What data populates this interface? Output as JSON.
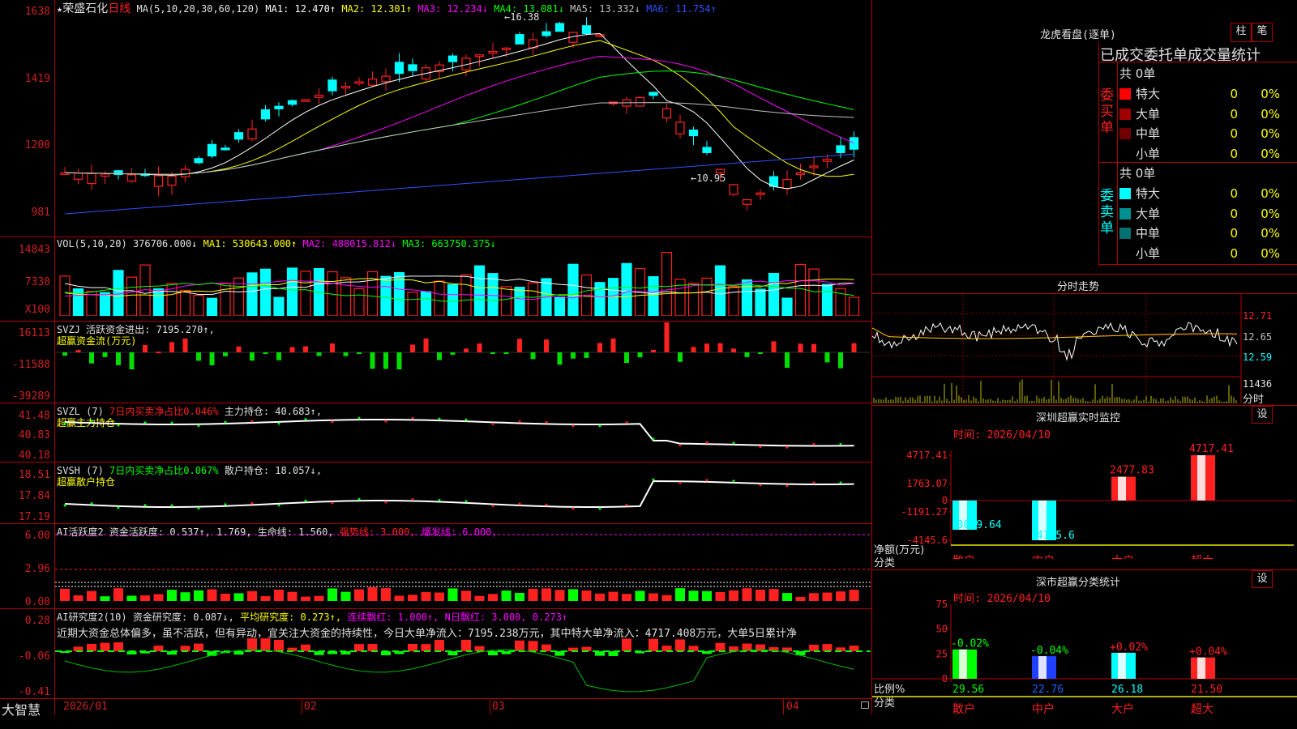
{
  "app": {
    "name": "大智慧"
  },
  "main_chart": {
    "star": "★",
    "stock_name": "荣盛石化",
    "period": "日线",
    "ma_params": "MA(5,10,20,30,60,120)",
    "ma1": "MA1: 12.470↑",
    "ma2": "MA2: 12.301↑",
    "ma3": "MA3: 12.234↓",
    "ma4": "MA4: 13.081↓",
    "ma5": "MA5: 13.332↓",
    "ma6": "MA6: 11.754↑",
    "high_label": "←16.38",
    "low_label": "←10.95",
    "y_ticks": [
      "1638",
      "1419",
      "1200",
      "981"
    ],
    "colors": {
      "ma1": "#ffffff",
      "ma2": "#ffff00",
      "ma3": "#ff00ff",
      "ma4": "#00ff00",
      "ma5": "#c0c0c0",
      "ma6": "#3050ff",
      "up": "#ff2020",
      "down": "#00ffff"
    }
  },
  "vol_panel": {
    "label": "VOL(5,10,20)",
    "value": "376706.000↓",
    "ma1": "MA1: 530643.000↑",
    "ma2": "MA2: 488015.812↓",
    "ma3": "MA3: 663750.375↓",
    "y_ticks": [
      "14843",
      "7330",
      "X100"
    ]
  },
  "svzj_panel": {
    "label": "SVZJ",
    "text": "活跃资金进出: 7195.270↑,",
    "sub": "超赢资金流(万元)",
    "y_ticks": [
      "16113",
      "-11588",
      "-39289"
    ]
  },
  "svzl_panel": {
    "label": "SVZL (7)",
    "ratio": "7日内买卖净占比0.046%",
    "hold": "主力持仓: 40.683↑,",
    "sub": "超赢主力持仓",
    "y_ticks": [
      "41.48",
      "40.83",
      "40.18"
    ]
  },
  "svsh_panel": {
    "label": "SVSH (7)",
    "ratio": "7日内买卖净占比0.067%",
    "hold": "散户持仓: 18.057↓,",
    "sub": "超赢散户持仓",
    "y_ticks": [
      "18.51",
      "17.84",
      "17.19"
    ]
  },
  "ai_active_panel": {
    "label": "AI活跃度2",
    "text1": "资金活跃度: 0.537↑, 1.769, 生命线: 1.560,",
    "strong": "强势线: 3.000,",
    "burst": "爆发线: 6.000,",
    "y_ticks": [
      "6.00",
      "2.96",
      "0.00"
    ]
  },
  "ai_research_panel": {
    "label": "AI研究度2(10)",
    "research": "资金研究度: 0.087↓,",
    "avg": "平均研究度: 0.273↑,",
    "cont": "连续飘红: 1.000↑,",
    "nday": "N日飘红: 3.000, 0.273↑",
    "comment": "近期大资金总体偏多，虽不活跃，但有异动，宜关注大资金的持续性，今日大单净流入：7195.238万元，其中特大单净流入：4717.408万元，大单5日累计净",
    "y_ticks": [
      "0.28",
      "-0.06",
      "-0.41"
    ]
  },
  "x_axis": {
    "labels": [
      "2026/01",
      "02",
      "03",
      "04"
    ]
  },
  "dragon_tiger": {
    "title": "龙虎看盘(逐单)",
    "btn1": "柱",
    "btn2": "笔",
    "subtitle": "已成交委托单成交量统计",
    "buy_label": "委买单",
    "sell_label": "委卖单",
    "buy_total": "共 0单",
    "sell_total": "共 0单",
    "buy_rows": [
      {
        "name": "特大",
        "count": "0",
        "pct": "0%",
        "color": "#ff0000"
      },
      {
        "name": "大单",
        "count": "0",
        "pct": "0%",
        "color": "#a00000"
      },
      {
        "name": "中单",
        "count": "0",
        "pct": "0%",
        "color": "#700000"
      },
      {
        "name": "小单",
        "count": "0",
        "pct": "0%",
        "color": "#000000"
      }
    ],
    "sell_rows": [
      {
        "name": "特大",
        "count": "0",
        "pct": "0%",
        "color": "#00ffff"
      },
      {
        "name": "大单",
        "count": "0",
        "pct": "0%",
        "color": "#009090"
      },
      {
        "name": "中单",
        "count": "0",
        "pct": "0%",
        "color": "#007070"
      },
      {
        "name": "小单",
        "count": "0",
        "pct": "0%",
        "color": "#000000"
      }
    ]
  },
  "intraday": {
    "title": "分时走势",
    "price_ticks": [
      "12.71",
      "12.65",
      "12.59"
    ],
    "vol_tick": "11436",
    "vol_label": "分时"
  },
  "sz_realtime": {
    "title": "深圳超赢实时监控",
    "settings": "设",
    "time": "时间: 2026/04/10",
    "y_label": "净额(万元)",
    "x_label": "分类",
    "chart_data": {
      "type": "bar",
      "categories": [
        "散户",
        "中户",
        "大户",
        "超大"
      ],
      "values": [
        -3049.64,
        -4145.6,
        2477.83,
        4717.41
      ],
      "value_labels": [
        "-3049.64",
        "-4145.6",
        "2477.83",
        "4717.41"
      ],
      "y_ticks": [
        "4717.41",
        "1763.07",
        "0",
        "-1191.27",
        "-4145.6"
      ],
      "ylim": [
        -4145.6,
        4717.41
      ]
    }
  },
  "sz_category": {
    "title": "深市超赢分类统计",
    "settings": "设",
    "time": "时间: 2026/04/10",
    "y_label": "比例%",
    "x_label": "分类",
    "chart_data": {
      "type": "bar",
      "categories": [
        "散户",
        "中户",
        "大户",
        "超大"
      ],
      "values": [
        29.56,
        22.76,
        26.18,
        21.5
      ],
      "value_labels": [
        "29.56",
        "22.76",
        "26.18",
        "21.50"
      ],
      "change_labels": [
        "-0.02%",
        "-0.04%",
        "+0.02%",
        "+0.04%"
      ],
      "y_ticks": [
        "75",
        "50",
        "25",
        "0"
      ],
      "ylim": [
        0,
        75
      ]
    }
  }
}
